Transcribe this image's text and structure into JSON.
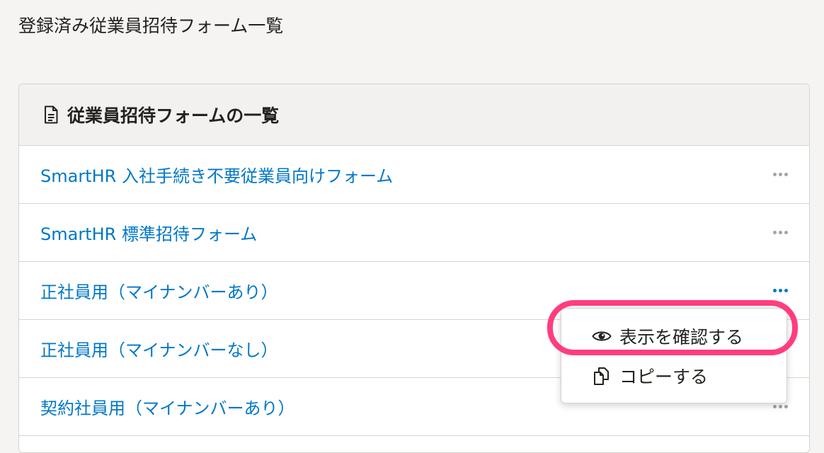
{
  "page": {
    "title": "登録済み従業員招待フォーム一覧"
  },
  "panel": {
    "title": "従業員招待フォームの一覧",
    "icon": "document-icon",
    "rows": [
      {
        "label": "SmartHR 入社手続き不要従業員向けフォーム"
      },
      {
        "label": "SmartHR 標準招待フォーム"
      },
      {
        "label": "正社員用（マイナンバーあり）"
      },
      {
        "label": "正社員用（マイナンバーなし）"
      },
      {
        "label": "契約社員用（マイナンバーあり）"
      }
    ]
  },
  "menu": {
    "items": [
      {
        "label": "表示を確認する",
        "icon": "eye-icon"
      },
      {
        "label": "コピーする",
        "icon": "copy-icon"
      }
    ]
  },
  "colors": {
    "link": "#0077c7",
    "highlight": "#ff3d7f",
    "muted": "#a7a4a1"
  }
}
